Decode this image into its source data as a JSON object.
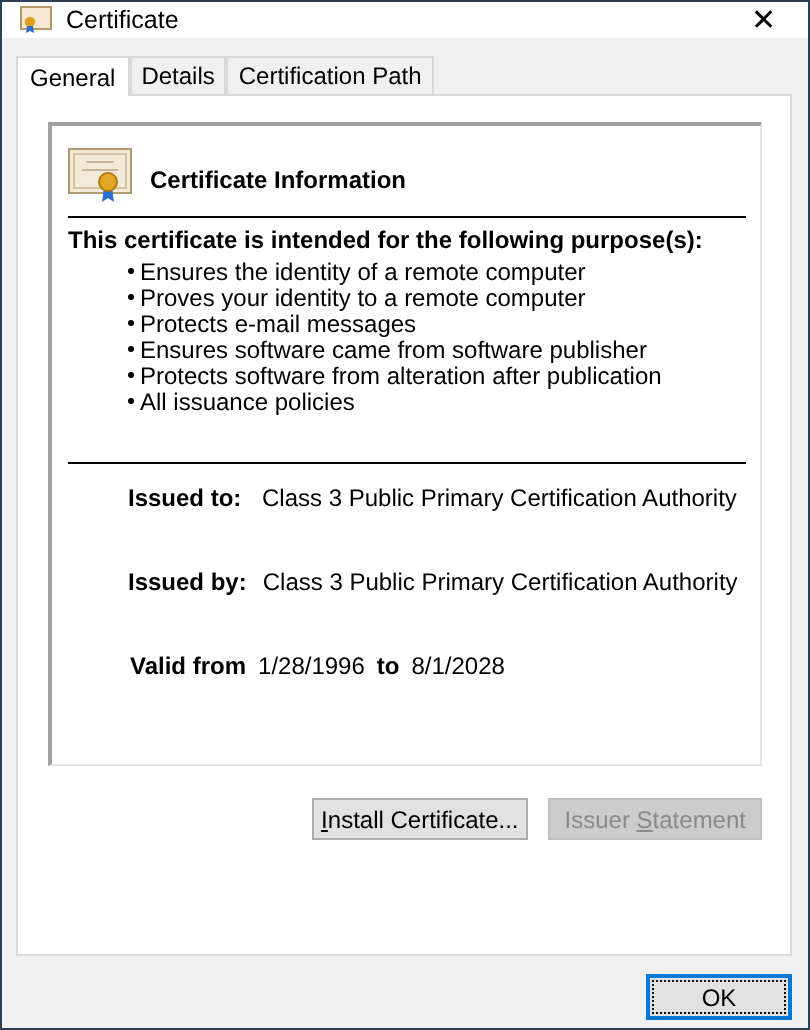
{
  "window": {
    "title": "Certificate",
    "close": "✕"
  },
  "tabs": [
    {
      "label": "General",
      "selected": true
    },
    {
      "label": "Details",
      "selected": false
    },
    {
      "label": "Certification Path",
      "selected": false
    }
  ],
  "info": {
    "heading": "Certificate Information",
    "purpose_heading": "This certificate is intended for the following purpose(s):",
    "purposes": [
      "Ensures the identity of a remote computer",
      "Proves your identity to a remote computer",
      "Protects e-mail messages",
      "Ensures software came from software publisher",
      "Protects software from alteration after publication",
      "All issuance policies"
    ],
    "issued_to_label": "Issued to:",
    "issued_to": "Class 3 Public Primary Certification Authority",
    "issued_by_label": "Issued by:",
    "issued_by": "Class 3 Public Primary Certification Authority",
    "valid_from_label": "Valid from",
    "valid_from": "1/28/1996",
    "valid_to_label": "to",
    "valid_to": "8/1/2028"
  },
  "buttons": [
    {
      "access_key": "I",
      "after": "nstall Certificate...",
      "disabled": false
    },
    {
      "before": "Issuer ",
      "access_key": "S",
      "after": "tatement",
      "disabled": true
    }
  ],
  "ok": {
    "label": "OK",
    "focused": true
  }
}
